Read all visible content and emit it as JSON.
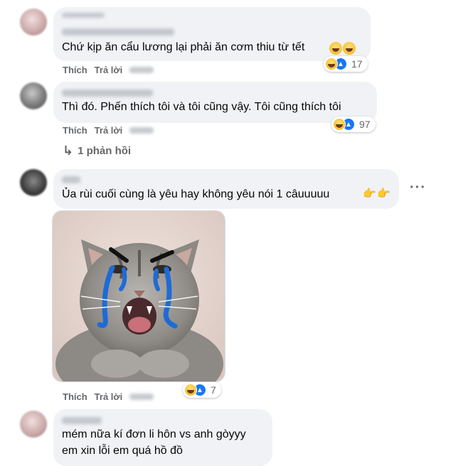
{
  "comments": [
    {
      "text": "Chứ kịp ăn cẩu lương lại phải ăn cơm thiu từ tết",
      "like_label": "Thích",
      "reply_label": "Trả lời",
      "reaction_count": "17"
    },
    {
      "text": "Thì đó. Phến thích tôi và tôi cũng vậy. Tôi cũng thích tôi",
      "like_label": "Thích",
      "reply_label": "Trả lời",
      "reaction_count": "97",
      "replies_label": "1 phản hồi"
    },
    {
      "text": "Ủa rùi cuối cùng là yêu hay không yêu nói 1 câuuuuu",
      "like_label": "Thích",
      "reply_label": "Trả lời",
      "reaction_count": "7",
      "more_label": "···"
    },
    {
      "text_line1": "mém nữa kí đơn li hôn vs anh gòyyy",
      "text_line2": "em xin lỗi em quá hồ đồ"
    }
  ],
  "icons": {
    "reply_arrow": "↳",
    "like_glyph": "👍",
    "point_glyph": "👉"
  },
  "colors": {
    "bubble": "#f0f2f5",
    "meta_text": "#65676b",
    "like_blue": "#1877f2",
    "haha_yellow": "#f7b928",
    "tear_blue": "#1e6bd6"
  }
}
